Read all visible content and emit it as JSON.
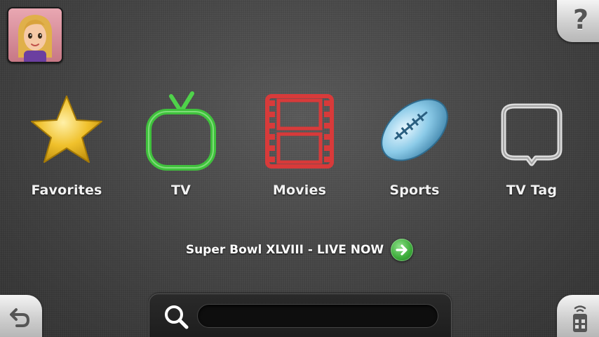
{
  "avatar": {
    "icon": "mii-avatar-icon"
  },
  "help": {
    "icon": "question-mark-icon",
    "glyph": "?"
  },
  "categories": [
    {
      "label": "Favorites",
      "icon": "star-icon",
      "color": "#e9b91f"
    },
    {
      "label": "TV",
      "icon": "tv-icon",
      "color": "#3fc13c"
    },
    {
      "label": "Movies",
      "icon": "film-strip-icon",
      "color": "#d83a3a"
    },
    {
      "label": "Sports",
      "icon": "football-icon",
      "color": "#5fb0d8"
    },
    {
      "label": "TV Tag",
      "icon": "speech-bubble-icon",
      "color": "#dcdcdc"
    }
  ],
  "banner": {
    "text": "Super Bowl XLVIII - LIVE NOW",
    "icon": "arrow-right-icon",
    "accent": "#3fae3c"
  },
  "search": {
    "icon": "search-icon",
    "value": "",
    "placeholder": ""
  },
  "back": {
    "icon": "back-arrow-icon"
  },
  "remote": {
    "icon": "remote-icon"
  }
}
